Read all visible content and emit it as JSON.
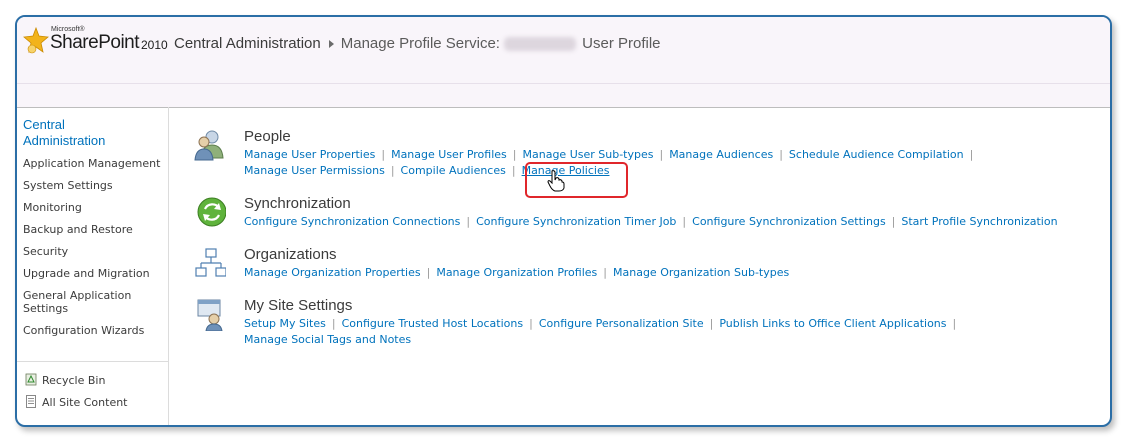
{
  "header": {
    "logo_microsoft": "Microsoft®",
    "logo_product": "SharePoint",
    "logo_year": "2010",
    "breadcrumb_home": "Central Administration",
    "breadcrumb_current_prefix": "Manage Profile Service:",
    "breadcrumb_current_suffix": "User Profile"
  },
  "leftnav": {
    "title": "Central Administration",
    "items": [
      "Application Management",
      "System Settings",
      "Monitoring",
      "Backup and Restore",
      "Security",
      "Upgrade and Migration",
      "General Application Settings",
      "Configuration Wizards"
    ],
    "recycle_bin": "Recycle Bin",
    "all_site_content": "All Site Content"
  },
  "sections": {
    "people": {
      "title": "People",
      "links_row1": [
        "Manage User Properties",
        "Manage User Profiles",
        "Manage User Sub-types",
        "Manage Audiences",
        "Schedule Audience Compilation"
      ],
      "links_row2": [
        "Manage User Permissions",
        "Compile Audiences",
        "Manage Policies"
      ]
    },
    "sync": {
      "title": "Synchronization",
      "links_row1": [
        "Configure Synchronization Connections",
        "Configure Synchronization Timer Job",
        "Configure Synchronization Settings",
        "Start Profile Synchronization"
      ]
    },
    "orgs": {
      "title": "Organizations",
      "links_row1": [
        "Manage Organization Properties",
        "Manage Organization Profiles",
        "Manage Organization Sub-types"
      ]
    },
    "mysite": {
      "title": "My Site Settings",
      "links_row1": [
        "Setup My Sites",
        "Configure Trusted Host Locations",
        "Configure Personalization Site",
        "Publish Links to Office Client Applications"
      ],
      "links_row2": [
        "Manage Social Tags and Notes"
      ]
    }
  },
  "colors": {
    "frame_border": "#2b6ea6",
    "link": "#0072bc",
    "highlight": "#e0262b"
  }
}
